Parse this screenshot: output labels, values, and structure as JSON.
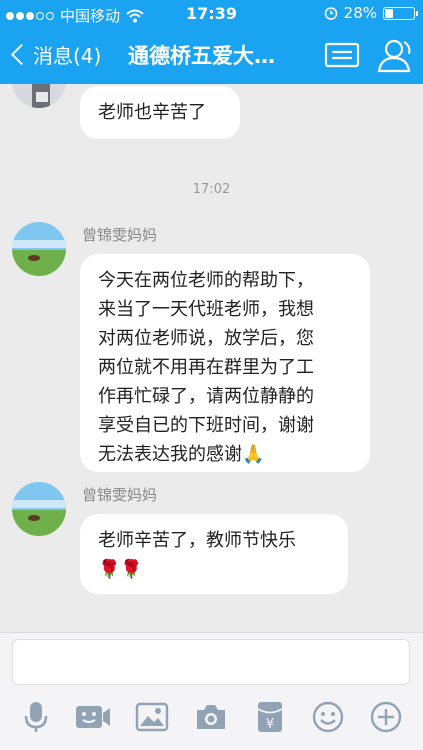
{
  "status": {
    "carrier": "中国移动",
    "time": "17:39",
    "battery": "28%",
    "battery_level": 0.28
  },
  "nav": {
    "back_label": "消息(4)",
    "title": "通德桥五爱大…"
  },
  "messages": [
    {
      "text": "老师也辛苦了"
    },
    {
      "timestamp": "17:02"
    },
    {
      "sender": "曾锦雯妈妈",
      "lines": [
        "今天在两位老师的帮助下，",
        "来当了一天代班老师，我想",
        "对两位老师说，放学后，您",
        "两位就不用再在群里为了工",
        "作再忙碌了，请两位静静的",
        "享受自已的下班时间，谢谢",
        "无法表达我的感谢🙏"
      ]
    },
    {
      "sender": "曾锦雯妈妈",
      "lines": [
        "老师辛苦了，教师节快乐",
        "🌹🌹"
      ]
    }
  ],
  "input": {
    "value": ""
  },
  "toolbar": [
    "microphone-icon",
    "video-icon",
    "image-icon",
    "camera-icon",
    "red-packet-icon",
    "emoji-icon",
    "plus-icon"
  ],
  "colors": {
    "accent": "#1aa3f0",
    "background": "#ebebeb",
    "bubble": "#ffffff"
  }
}
